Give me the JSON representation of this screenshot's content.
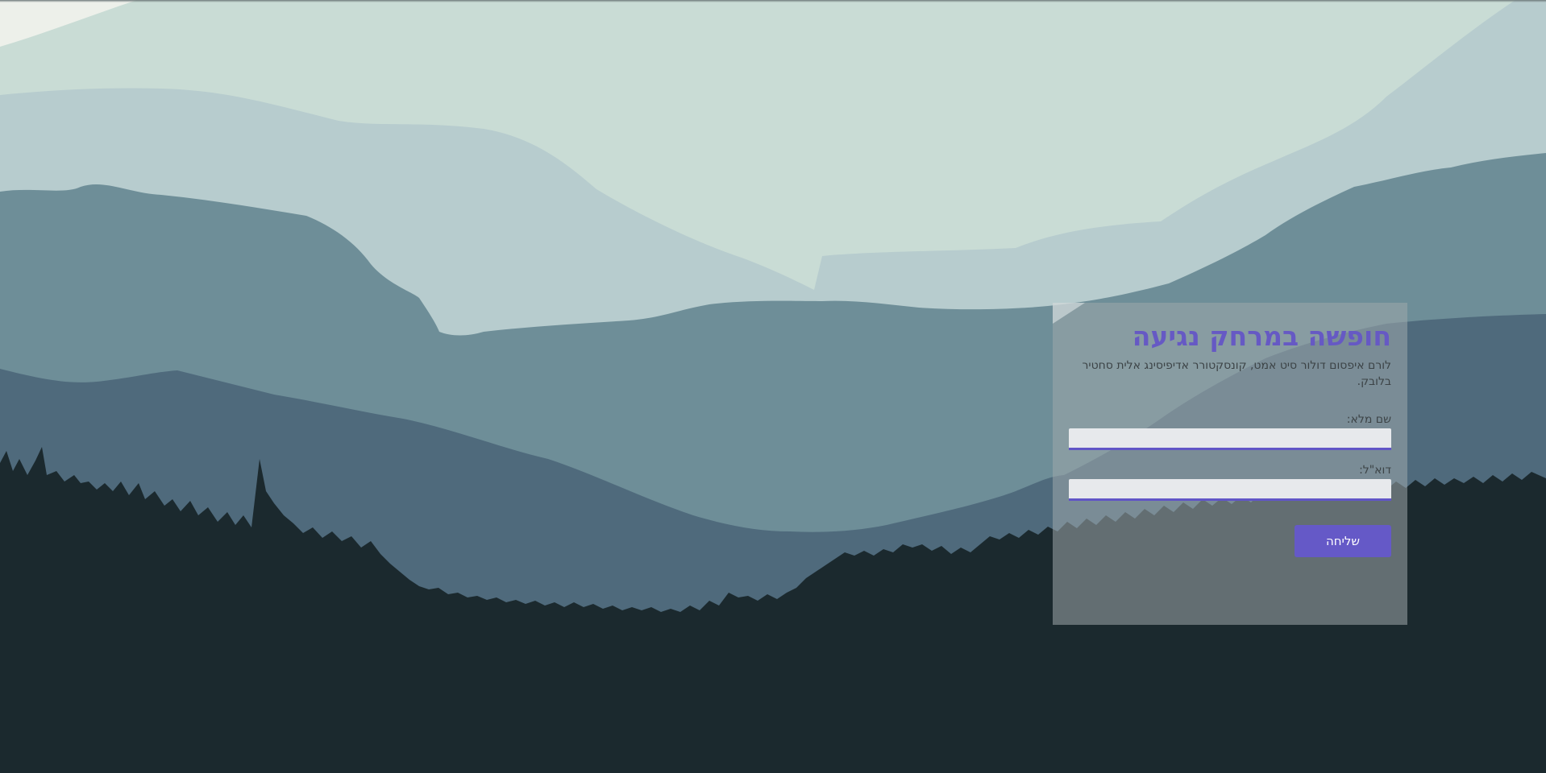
{
  "form": {
    "title": "חופשה במרחק נגיעה",
    "subtitle": "לורם איפסום דולור סיט אמט, קונסקטורר אדיפיסינג אלית סחטיר בלובק.",
    "fields": [
      {
        "label": "שם מלא:",
        "value": "",
        "placeholder": ""
      },
      {
        "label": "דוא\"ל:",
        "value": "",
        "placeholder": ""
      }
    ],
    "submit_label": "שליחה"
  },
  "colors": {
    "accent": "#6659c4",
    "sky": "#c9dcd5",
    "far_hills": "#b7ccce",
    "mid_hills": "#6e8e98",
    "near_hills": "#4f6a7c",
    "forest": "#1b292e"
  }
}
